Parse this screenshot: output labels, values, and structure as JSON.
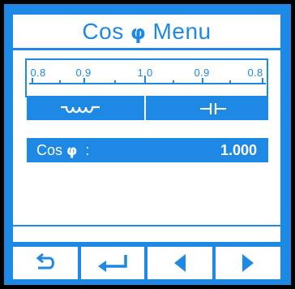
{
  "menu": {
    "title_text": "Cos",
    "title_symbol": "φ",
    "title_suffix": "Menu"
  },
  "scale": {
    "labels": [
      "0.8",
      "0.9",
      "1.0",
      "0.9",
      "0.8"
    ],
    "left_icon": "inductive-coil-icon",
    "right_icon": "capacitor-icon",
    "needle_value": 1.0
  },
  "readout": {
    "label_text": "Cos",
    "label_symbol": "φ",
    "label_colon": ":",
    "value": "1.000"
  },
  "buttons": [
    {
      "icon": "back-arrow-icon"
    },
    {
      "icon": "enter-icon"
    },
    {
      "icon": "left-triangle-icon"
    },
    {
      "icon": "right-triangle-icon"
    }
  ],
  "colors": {
    "accent": "#1e88e5",
    "background": "#ffffff",
    "bezel": "#000000"
  }
}
